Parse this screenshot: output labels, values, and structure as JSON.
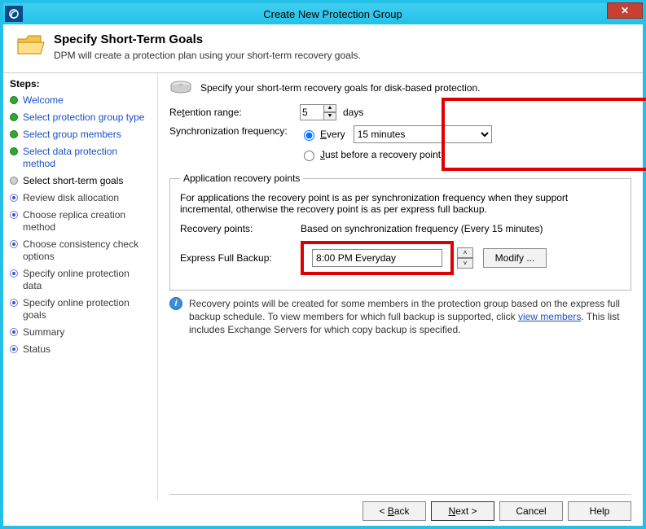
{
  "window": {
    "title": "Create New Protection Group",
    "close_label": "✕"
  },
  "header": {
    "title": "Specify Short-Term Goals",
    "subtitle": "DPM will create a protection plan using your short-term recovery goals."
  },
  "sidebar": {
    "heading": "Steps:",
    "items": [
      {
        "label": "Welcome",
        "state": "completed"
      },
      {
        "label": "Select protection group type",
        "state": "completed"
      },
      {
        "label": "Select group members",
        "state": "completed"
      },
      {
        "label": "Select data protection method",
        "state": "completed"
      },
      {
        "label": "Select short-term goals",
        "state": "current"
      },
      {
        "label": "Review disk allocation",
        "state": "pending"
      },
      {
        "label": "Choose replica creation method",
        "state": "pending"
      },
      {
        "label": "Choose consistency check options",
        "state": "pending"
      },
      {
        "label": "Specify online protection data",
        "state": "pending"
      },
      {
        "label": "Specify online protection goals",
        "state": "pending"
      },
      {
        "label": "Summary",
        "state": "pending"
      },
      {
        "label": "Status",
        "state": "pending"
      }
    ]
  },
  "main": {
    "intro": "Specify your short-term recovery goals for disk-based protection.",
    "retention": {
      "label": "Retention range:",
      "value": "5",
      "unit": "days"
    },
    "sync": {
      "label": "Synchronization frequency:",
      "every_prefix": "E",
      "every_label": "very",
      "freq_value": "15 minutes",
      "before_prefix": "J",
      "before_label": "ust before a recovery point"
    },
    "arp": {
      "legend": "Application recovery points",
      "desc": "For applications the recovery point is as per synchronization frequency when they support incremental, otherwise the recovery point is as per express full backup.",
      "recpoints_label": "Recovery points:",
      "recpoints_value": "Based on synchronization frequency (Every 15 minutes)",
      "efb_label": "Express Full Backup:",
      "efb_value": "8:00 PM Everyday",
      "modify_label": "Modify ..."
    },
    "info": {
      "text1": "Recovery points will be created for some members in the protection group based on the express full backup schedule. To view members for which full backup is supported, click ",
      "link": "view members",
      "text2": ". This list includes Exchange Servers for which copy backup is specified."
    }
  },
  "footer": {
    "back": "< Back",
    "next": "Next >",
    "cancel": "Cancel",
    "help": "Help"
  }
}
